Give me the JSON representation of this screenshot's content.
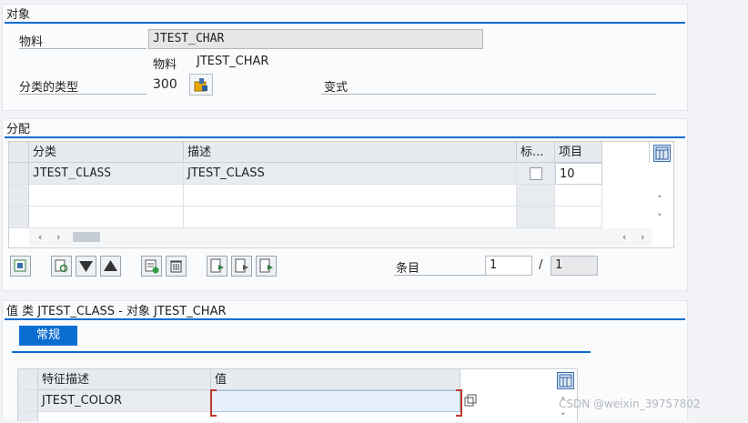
{
  "object_panel": {
    "title": "对象",
    "material_label": "物料",
    "material_value": "JTEST_CHAR",
    "sub_caption_label": "物料",
    "sub_caption_value": "JTEST_CHAR",
    "class_type_label": "分类的类型",
    "class_type_value": "300",
    "variant_label": "变式"
  },
  "assign_panel": {
    "title": "分配",
    "columns": [
      "分类",
      "描述",
      "标...",
      "项目"
    ],
    "rows": [
      {
        "class": "JTEST_CLASS",
        "desc": "JTEST_CLASS",
        "flag": false,
        "item": "10"
      }
    ],
    "entries_label": "条目",
    "entries_current": "1",
    "entries_sep": "/",
    "entries_total": "1"
  },
  "values_panel": {
    "title": "值 类 JTEST_CLASS - 对象 JTEST_CHAR",
    "tab_general": "常规",
    "columns": [
      "特征描述",
      "值"
    ],
    "rows": [
      {
        "char_desc": "JTEST_COLOR",
        "value": ""
      }
    ]
  },
  "watermark": "CSDN @weixin_39757802",
  "colors": {
    "accent": "#0a6ed1",
    "background": "#f1f3f6"
  }
}
